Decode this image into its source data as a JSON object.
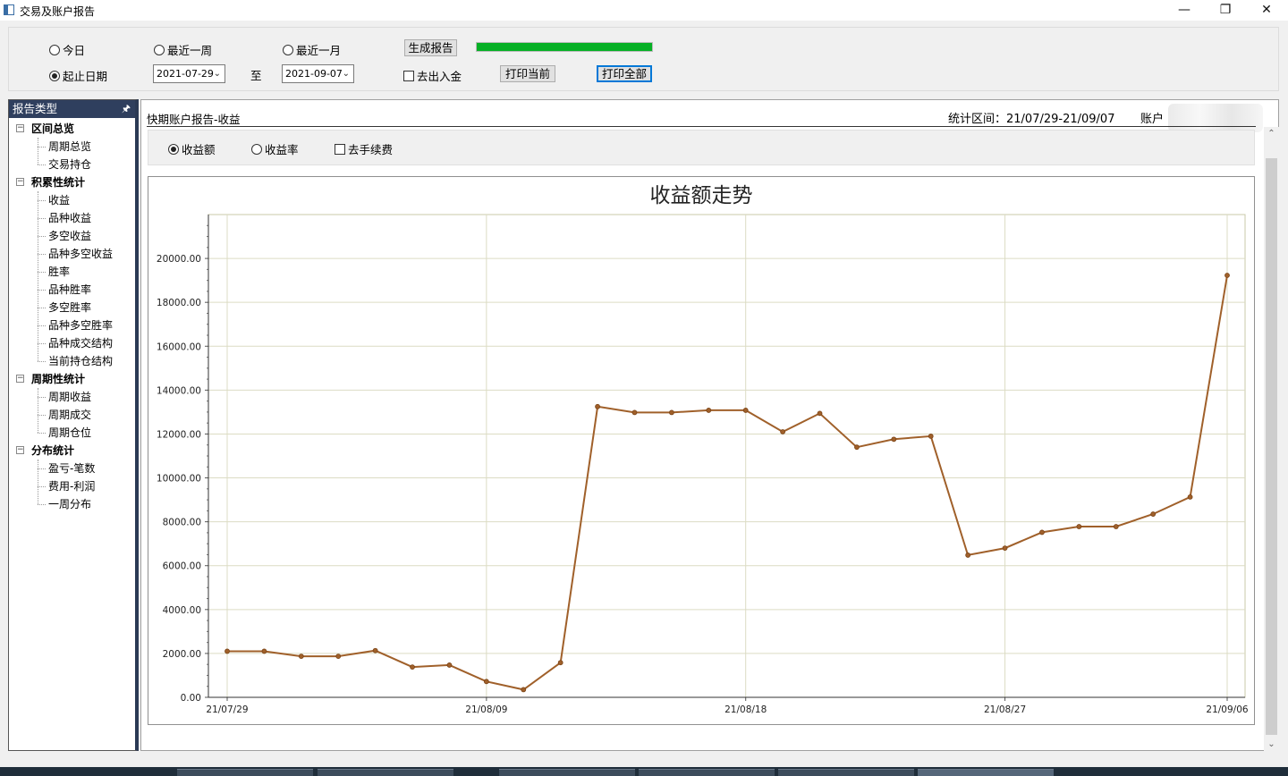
{
  "window": {
    "title": "交易及账户报告",
    "minimize": "—",
    "restore": "❐",
    "close": "✕"
  },
  "toolbar": {
    "radio_today": "今日",
    "radio_week": "最近一周",
    "radio_month": "最近一月",
    "radio_range": "起止日期",
    "selected_radio": "起止日期",
    "start_date": "2021-07-29",
    "to_label": "至",
    "end_date": "2021-09-07",
    "generate_label": "生成报告",
    "exclude_deposit_label": "去出入金",
    "exclude_deposit_checked": false,
    "print_current_label": "打印当前",
    "print_all_label": "打印全部",
    "progress": 1.0,
    "progress_color": "#06b025"
  },
  "sidebar": {
    "header": "报告类型",
    "pin": "ᵖ",
    "groups": [
      {
        "label": "区间总览",
        "items": [
          "周期总览",
          "交易持仓"
        ]
      },
      {
        "label": "积累性统计",
        "items": [
          "收益",
          "品种收益",
          "多空收益",
          "品种多空收益",
          "胜率",
          "品种胜率",
          "多空胜率",
          "品种多空胜率",
          "品种成交结构",
          "当前持仓结构"
        ]
      },
      {
        "label": "周期性统计",
        "items": [
          "周期收益",
          "周期成交",
          "周期仓位"
        ]
      },
      {
        "label": "分布统计",
        "items": [
          "盈亏-笔数",
          "费用-利润",
          "一周分布"
        ]
      }
    ]
  },
  "report": {
    "title": "快期账户报告-收益",
    "range": "统计区间：21/07/29-21/09/07",
    "account_label": "账户",
    "options": {
      "amount": "收益额",
      "rate": "收益率",
      "fee": "去手续费",
      "selected": "收益额",
      "fee_checked": false
    }
  },
  "chart_data": {
    "type": "line",
    "title": "收益额走势",
    "xlabel": "",
    "ylabel": "",
    "ylim": [
      0,
      22000
    ],
    "yticks": [
      0,
      2000,
      4000,
      6000,
      8000,
      10000,
      12000,
      14000,
      16000,
      18000,
      20000
    ],
    "ytick_labels": [
      "0.00",
      "2000.00",
      "4000.00",
      "6000.00",
      "8000.00",
      "10000.00",
      "12000.00",
      "14000.00",
      "16000.00",
      "18000.00",
      "20000.00"
    ],
    "xtick_labels": [
      {
        "index": 0,
        "label": "21/07/29"
      },
      {
        "index": 7,
        "label": "21/08/09"
      },
      {
        "index": 14,
        "label": "21/08/18"
      },
      {
        "index": 21,
        "label": "21/08/27"
      },
      {
        "index": 27,
        "label": "21/09/06"
      }
    ],
    "line_color": "#a0602a",
    "grid": true,
    "series": [
      {
        "values": [
          2100,
          2100,
          1870,
          1870,
          2130,
          1380,
          1470,
          720,
          350,
          1580,
          13250,
          12980,
          12980,
          13080,
          13080,
          12100,
          12940,
          11400,
          11760,
          11900,
          6480,
          6800,
          7520,
          7780,
          7780,
          8350,
          9130,
          19230
        ]
      }
    ]
  }
}
